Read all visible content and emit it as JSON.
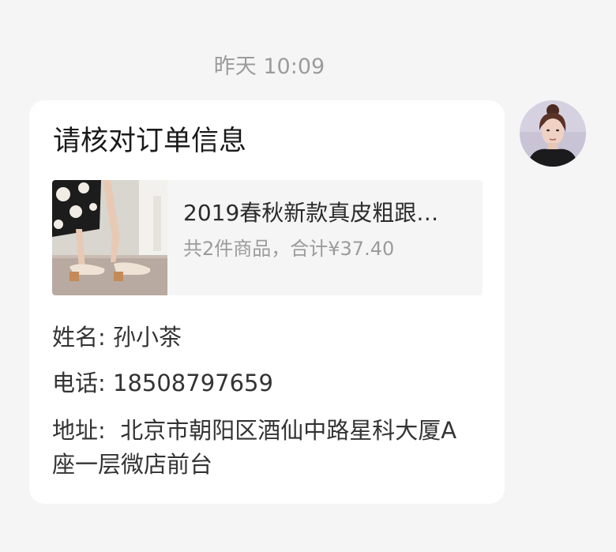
{
  "chat": {
    "timestamp": "昨天 10:09"
  },
  "order_card": {
    "title": "请核对订单信息",
    "product": {
      "name": "2019春秋新款真皮粗跟…",
      "summary": "共2件商品，合计¥37.40",
      "image_icon": "shoes-product-photo"
    },
    "recipient": {
      "name_label": "姓名:",
      "name_value": "孙小茶",
      "phone_label": "电话:",
      "phone_value": "18508797659",
      "address_label": "地址:",
      "address_value_line1": "北京市朝阳区酒仙中路星科大厦A",
      "address_value_line2": "座一层微店前台"
    }
  },
  "sender": {
    "avatar_icon": "user-avatar"
  },
  "colors": {
    "background": "#f5f5f6",
    "bubble": "#ffffff",
    "muted_text": "#9b9b9b",
    "primary_text": "#222222"
  }
}
